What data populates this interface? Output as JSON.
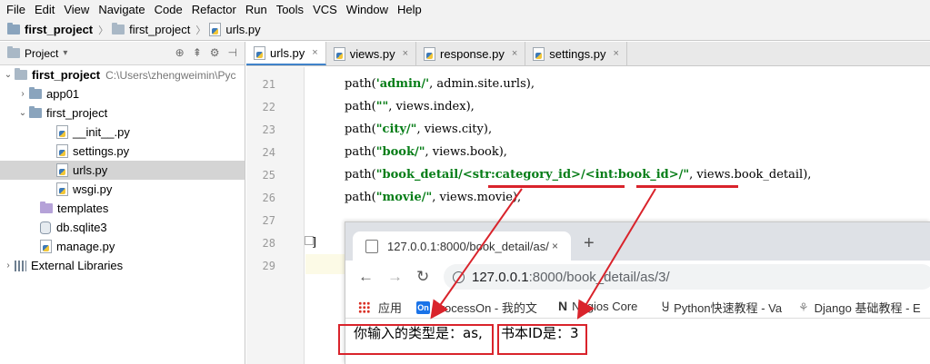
{
  "menu": [
    "File",
    "Edit",
    "View",
    "Navigate",
    "Code",
    "Refactor",
    "Run",
    "Tools",
    "VCS",
    "Window",
    "Help"
  ],
  "breadcrumb": [
    "first_project",
    "first_project",
    "urls.py"
  ],
  "project_panel": {
    "title": "Project",
    "tree": [
      {
        "label": "first_project",
        "hint": "C:\\Users\\zhengweimin\\Pyc"
      },
      {
        "label": "app01"
      },
      {
        "label": "first_project"
      },
      {
        "label": "__init__.py"
      },
      {
        "label": "settings.py"
      },
      {
        "label": "urls.py"
      },
      {
        "label": "wsgi.py"
      },
      {
        "label": "templates"
      },
      {
        "label": "db.sqlite3"
      },
      {
        "label": "manage.py"
      },
      {
        "label": "External Libraries"
      }
    ]
  },
  "tabs": [
    "urls.py",
    "views.py",
    "response.py",
    "settings.py"
  ],
  "code": {
    "line_numbers": [
      "21",
      "22",
      "23",
      "24",
      "25",
      "26",
      "27",
      "28",
      "29"
    ],
    "lines": [
      {
        "pre": "path(",
        "str": "'admin/'",
        "post": ", admin.site.urls),"
      },
      {
        "pre": "path(",
        "str": "\"\"",
        "post": ", views.index),"
      },
      {
        "pre": "path(",
        "str": "\"city/\"",
        "post": ", views.city),"
      },
      {
        "pre": "path(",
        "str": "\"book/\"",
        "post": ", views.book),"
      },
      {
        "pre": "path(",
        "str": "\"book_detail/<str:category_id>/<int:book_id>/\"",
        "post": ", views.book_detail),"
      },
      {
        "pre": "path(",
        "str": "\"movie/\"",
        "post": ", views.movie),"
      },
      {
        "pre": "",
        "str": "",
        "post": ""
      },
      {
        "pre": "]",
        "str": "",
        "post": ""
      },
      {
        "pre": "",
        "str": "",
        "post": ""
      }
    ]
  },
  "browser": {
    "tab_title": "127.0.0.1:8000/book_detail/as/",
    "tab_close": "×",
    "new_tab": "+",
    "url_host": "127.0.0.1",
    "url_rest": ":8000/book_detail/as/3/",
    "bookmarks": [
      "应用",
      "ProcessOn - 我的文",
      "Nagios Core",
      "Python快速教程 - Va",
      "Django 基础教程 - E"
    ],
    "content_part1": "你输入的类型是：as,",
    "content_part2": "书本ID是：3"
  },
  "colors": {
    "annotation_red": "#d9232b",
    "string_green": "#067d17",
    "active_tab_blue": "#4083c9"
  }
}
